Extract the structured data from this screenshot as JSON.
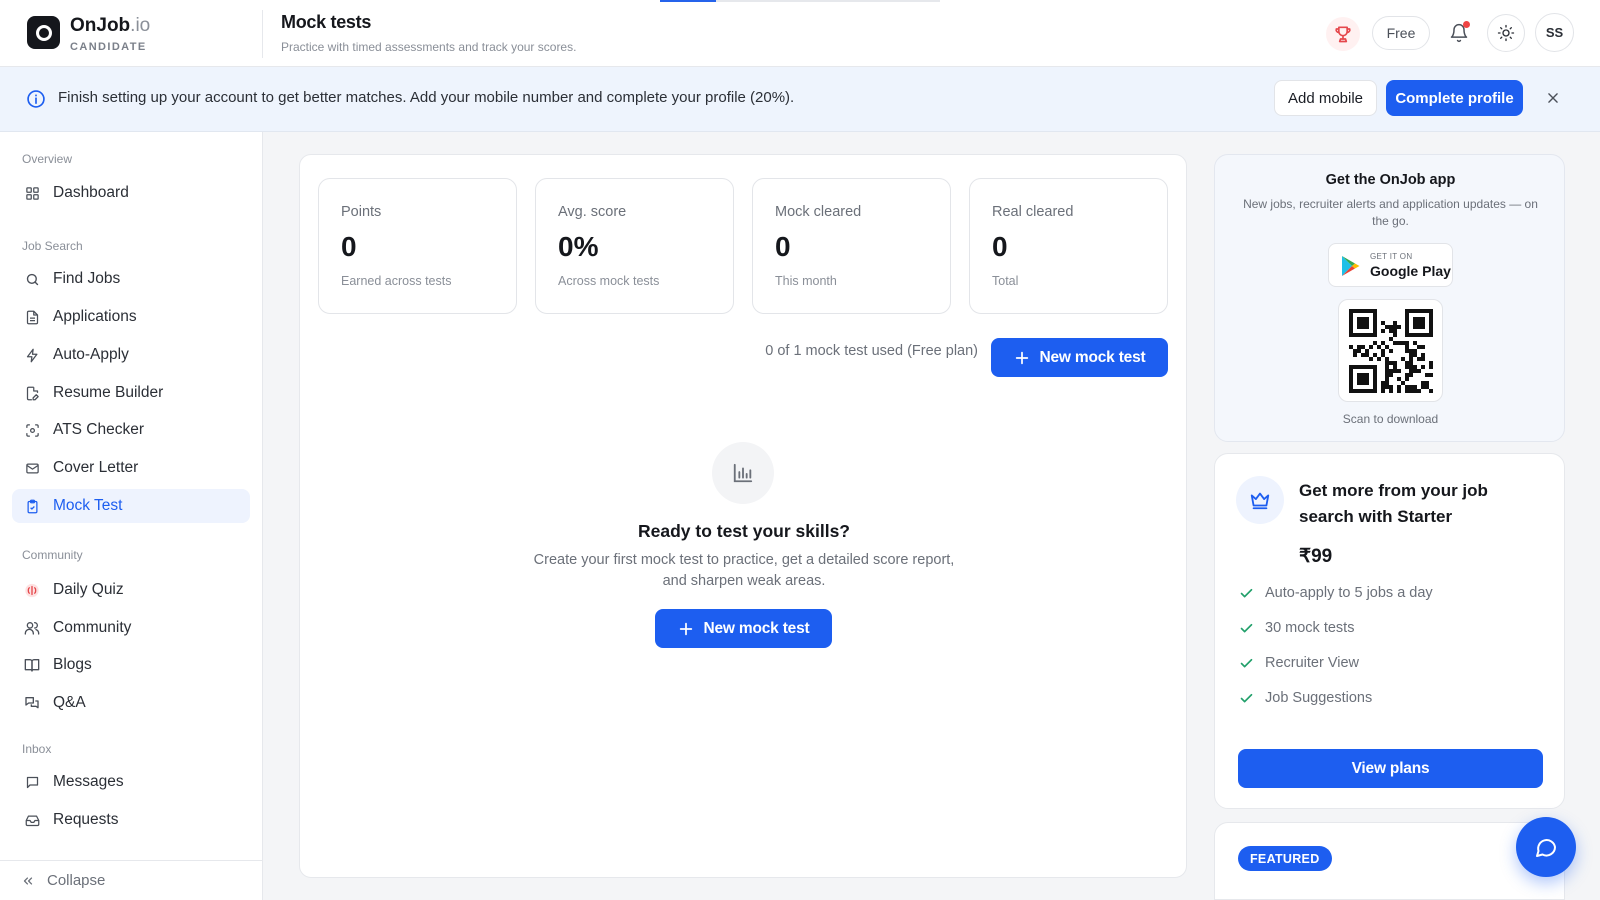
{
  "app": {
    "brand_name": "OnJob",
    "brand_tld": ".io",
    "brand_role": "CANDIDATE",
    "top_progress_pct": 20
  },
  "header": {
    "title": "Mock tests",
    "subtitle": "Practice with timed assessments and track your scores.",
    "plan_label": "Free",
    "avatar_initials": "SS",
    "has_unread_notifications": true,
    "icons": [
      "trophy-icon",
      "bell-icon",
      "sun-icon"
    ]
  },
  "banner": {
    "text": "Finish setting up your account to get better matches. Add your mobile number and complete your profile (20%).",
    "add_mobile_label": "Add mobile",
    "complete_profile_label": "Complete profile"
  },
  "sidebar": {
    "sections": [
      {
        "label": "Overview",
        "items": [
          {
            "label": "Dashboard",
            "icon": "grid-icon"
          }
        ]
      },
      {
        "label": "Job Search",
        "items": [
          {
            "label": "Find Jobs",
            "icon": "search-icon"
          },
          {
            "label": "Applications",
            "icon": "file-icon"
          },
          {
            "label": "Auto-Apply",
            "icon": "zap-icon"
          },
          {
            "label": "Resume Builder",
            "icon": "file-edit-icon"
          },
          {
            "label": "ATS Checker",
            "icon": "scan-icon"
          },
          {
            "label": "Cover Letter",
            "icon": "mail-icon"
          },
          {
            "label": "Mock Test",
            "icon": "clipboard-icon",
            "active": true
          }
        ]
      },
      {
        "label": "Community",
        "items": [
          {
            "label": "Daily Quiz",
            "icon": "brain-icon"
          },
          {
            "label": "Community",
            "icon": "users-icon"
          },
          {
            "label": "Blogs",
            "icon": "book-icon"
          },
          {
            "label": "Q&A",
            "icon": "chat-bubbles-icon"
          }
        ]
      },
      {
        "label": "Inbox",
        "items": [
          {
            "label": "Messages",
            "icon": "message-icon"
          },
          {
            "label": "Requests",
            "icon": "inbox-icon"
          }
        ]
      }
    ],
    "collapse_label": "Collapse"
  },
  "stats": [
    {
      "label": "Points",
      "value": "0",
      "caption": "Earned across tests"
    },
    {
      "label": "Avg. score",
      "value": "0%",
      "caption": "Across mock tests"
    },
    {
      "label": "Mock cleared",
      "value": "0",
      "caption": "This month"
    },
    {
      "label": "Real cleared",
      "value": "0",
      "caption": "Total"
    }
  ],
  "usage": {
    "text": "0 of 1 mock test used (Free plan)",
    "new_button_label": "New mock test"
  },
  "empty_state": {
    "icon": "bar-chart-icon",
    "title": "Ready to test your skills?",
    "description": "Create your first mock test to practice, get a detailed score report, and sharpen weak areas.",
    "button_label": "New mock test"
  },
  "app_promo": {
    "title": "Get the OnJob app",
    "description": "New jobs, recruiter alerts and application updates — on the go.",
    "store_small": "GET IT ON",
    "store_big": "Google Play",
    "scan_label": "Scan to download"
  },
  "upgrade": {
    "headline": "Get more from your job search with Starter",
    "price": "₹99",
    "features": [
      "Auto-apply to 5 jobs a day",
      "30 mock tests",
      "Recruiter View",
      "Job Suggestions"
    ],
    "button_label": "View plans"
  },
  "featured": {
    "badge": "FEATURED"
  },
  "colors": {
    "accent": "#1d5ef0",
    "banner_bg": "#eef4fd",
    "check": "#22a06b",
    "alert": "#ef4444"
  }
}
